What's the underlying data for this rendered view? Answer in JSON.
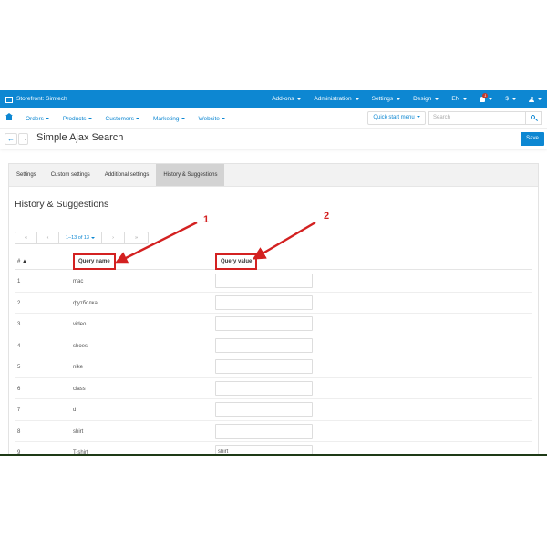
{
  "topbar": {
    "brand": "Storefront: Simtech",
    "menu": [
      "Add-ons",
      "Administration",
      "Settings",
      "Design",
      "EN"
    ],
    "notifications_count": "1",
    "currency": "$"
  },
  "nav": {
    "items": [
      "Orders",
      "Products",
      "Customers",
      "Marketing",
      "Website"
    ],
    "quick_start": "Quick start menu",
    "search_placeholder": "Search"
  },
  "titlebar": {
    "title": "Simple Ajax Search",
    "save_label": "Save"
  },
  "tabs": [
    "Settings",
    "Custom settings",
    "Additional settings",
    "History & Suggestions"
  ],
  "section_title": "History & Suggestions",
  "pager": {
    "first": "«",
    "prev": "‹",
    "range": "1–13 of 13",
    "next": "›",
    "last": "»"
  },
  "table": {
    "headers": {
      "num": "# ▲",
      "name": "Query name",
      "value": "Query value"
    },
    "rows": [
      {
        "num": "1",
        "name": "mac",
        "value": ""
      },
      {
        "num": "2",
        "name": "футболка",
        "value": ""
      },
      {
        "num": "3",
        "name": "video",
        "value": ""
      },
      {
        "num": "4",
        "name": "shoes",
        "value": ""
      },
      {
        "num": "5",
        "name": "nike",
        "value": ""
      },
      {
        "num": "6",
        "name": "class",
        "value": ""
      },
      {
        "num": "7",
        "name": "d",
        "value": ""
      },
      {
        "num": "8",
        "name": "shirt",
        "value": ""
      },
      {
        "num": "9",
        "name": "T-shirt",
        "value": "shirt"
      }
    ]
  },
  "annotations": [
    "1",
    "2"
  ],
  "colors": {
    "brand": "#0d87d2",
    "annotation": "#d32121"
  }
}
